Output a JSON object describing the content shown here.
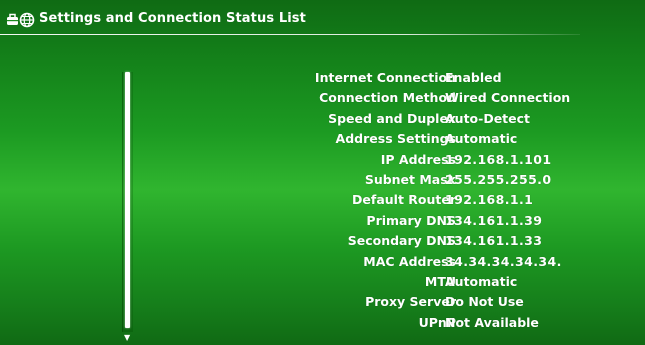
{
  "header": {
    "title": "Settings and Connection Status List",
    "icons": [
      "settings-toolbox-icon",
      "network-globe-icon"
    ]
  },
  "status": {
    "rows": [
      {
        "label": "Internet Connection",
        "value": "Enabled"
      },
      {
        "label": "Connection Method",
        "value": "Wired Connection"
      },
      {
        "label": "Speed and Duplex",
        "value": "Auto-Detect"
      },
      {
        "label": "Address Settings",
        "value": "Automatic"
      },
      {
        "label": "IP Address",
        "value": "192.168.1.101"
      },
      {
        "label": "Subnet Mask",
        "value": "255.255.255.0"
      },
      {
        "label": "Default Router",
        "value": "192.168.1.1"
      },
      {
        "label": "Primary DNS",
        "value": "134.161.1.39"
      },
      {
        "label": "Secondary DNS",
        "value": "134.161.1.33"
      },
      {
        "label": "MAC Address",
        "value": "34.34.34.34.34."
      },
      {
        "label": "MTU",
        "value": "Automatic"
      },
      {
        "label": "Proxy Server",
        "value": "Do Not Use"
      },
      {
        "label": "UPnP",
        "value": "Not Available"
      }
    ]
  },
  "scrollbar": {
    "down_arrow": "▼"
  },
  "colors": {
    "background": "#1c9a22",
    "text": "#ffffff"
  }
}
